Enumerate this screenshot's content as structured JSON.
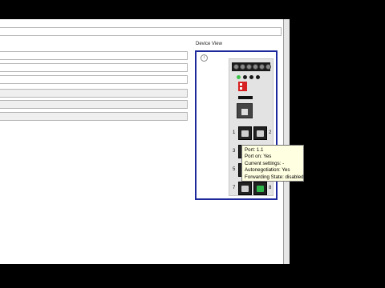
{
  "device_view": {
    "title": "Device View",
    "info_icon": "info-icon",
    "leds": [
      "#3ec24a",
      "#1a1a1a",
      "#1a1a1a",
      "#1a1a1a"
    ],
    "ports": [
      {
        "number": "1",
        "active": false
      },
      {
        "number": "2",
        "active": false
      },
      {
        "number": "3",
        "active": false
      },
      {
        "number": "4",
        "active": false
      },
      {
        "number": "5",
        "active": false
      },
      {
        "number": "6",
        "active": false
      },
      {
        "number": "7",
        "active": false
      },
      {
        "number": "8",
        "active": true
      }
    ]
  },
  "tooltip": {
    "port": "Port: 1.1",
    "port_on": "Port on: Yes",
    "current_settings": "Current settings: -",
    "autonegotiation": "Autonegotiation: Yes",
    "forwarding_state": "Forwarding State: disabled"
  },
  "colors": {
    "frame_border": "#1e2a9c",
    "tooltip_bg": "#ffffe1",
    "dip_switch": "#d62222"
  }
}
